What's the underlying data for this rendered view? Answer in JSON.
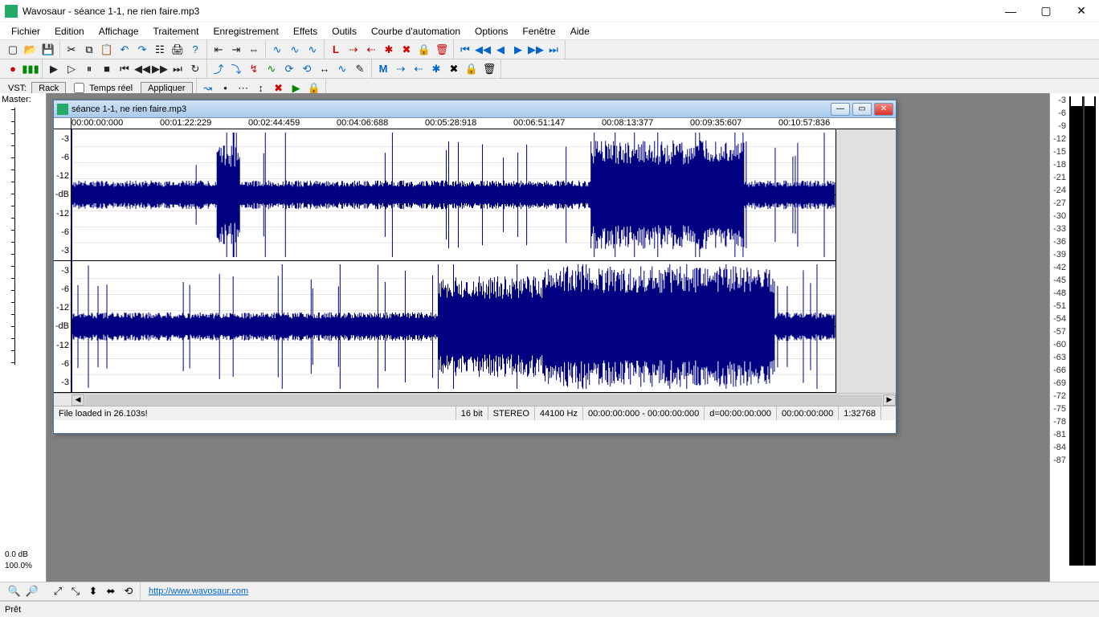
{
  "titlebar": {
    "title": "Wavosaur - séance 1-1, ne rien faire.mp3"
  },
  "menubar": [
    "Fichier",
    "Edition",
    "Affichage",
    "Traitement",
    "Enregistrement",
    "Effets",
    "Outils",
    "Courbe d'automation",
    "Options",
    "Fenêtre",
    "Aide"
  ],
  "vst_row": {
    "label": "VST:",
    "rack": "Rack",
    "realtime": "Temps réel",
    "apply": "Appliquer"
  },
  "master": {
    "label": "Master:",
    "db": "0.0 dB",
    "pct": "100.0%"
  },
  "child": {
    "title": "séance 1-1, ne rien faire.mp3",
    "timestamps": [
      "00:00:00:000",
      "00:01:22:229",
      "00:02:44:459",
      "00:04:06:688",
      "00:05:28:918",
      "00:06:51:147",
      "00:08:13:377",
      "00:09:35:607",
      "00:10:57:836"
    ],
    "db_labels_top": [
      "-3",
      "-6",
      "-12",
      "-dB",
      "-12",
      "-6",
      "-3"
    ],
    "db_labels_bot": [
      "-3",
      "-6",
      "-12",
      "-dB",
      "-12",
      "-6",
      "-3"
    ],
    "status": {
      "loaded": "File loaded in 26.103s!",
      "bits": "16 bit",
      "stereo": "STEREO",
      "rate": "44100 Hz",
      "range": "00:00:00:000 - 00:00:00:000",
      "dur": "d=00:00:00:000",
      "pos": "00:00:00:000",
      "samples": "1:32768"
    }
  },
  "right_meter": [
    "-3",
    "-6",
    "-9",
    "-12",
    "-15",
    "-18",
    "-21",
    "-24",
    "-27",
    "-30",
    "-33",
    "-36",
    "-39",
    "-42",
    "-45",
    "-48",
    "-51",
    "-54",
    "-57",
    "-60",
    "-63",
    "-66",
    "-69",
    "-72",
    "-75",
    "-78",
    "-81",
    "-84",
    "-87"
  ],
  "bottom": {
    "url": "http://www.wavosaur.com"
  },
  "statusbar": {
    "text": "Prêt"
  }
}
